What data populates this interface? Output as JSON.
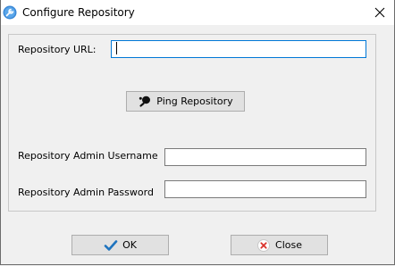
{
  "window": {
    "title": "Configure Repository",
    "app_icon": "gear-wrench-icon",
    "close_icon": "close-icon"
  },
  "form": {
    "repository_url_label": "Repository URL:",
    "repository_url_value": "",
    "ping_button_label": "Ping Repository",
    "ping_button_icon": "ping-pong-paddle-icon",
    "admin_username_label": "Repository Admin Username",
    "admin_username_value": "",
    "admin_password_label": "Repository Admin Password",
    "admin_password_value": ""
  },
  "footer": {
    "ok_label": "OK",
    "ok_icon": "checkmark-icon",
    "close_label": "Close",
    "close_icon": "cancel-circle-icon"
  },
  "colors": {
    "focus_border": "#0078d7",
    "ok_check": "#1e73be",
    "close_icon_red": "#d9322b",
    "app_icon_blue": "#3a88d6"
  }
}
